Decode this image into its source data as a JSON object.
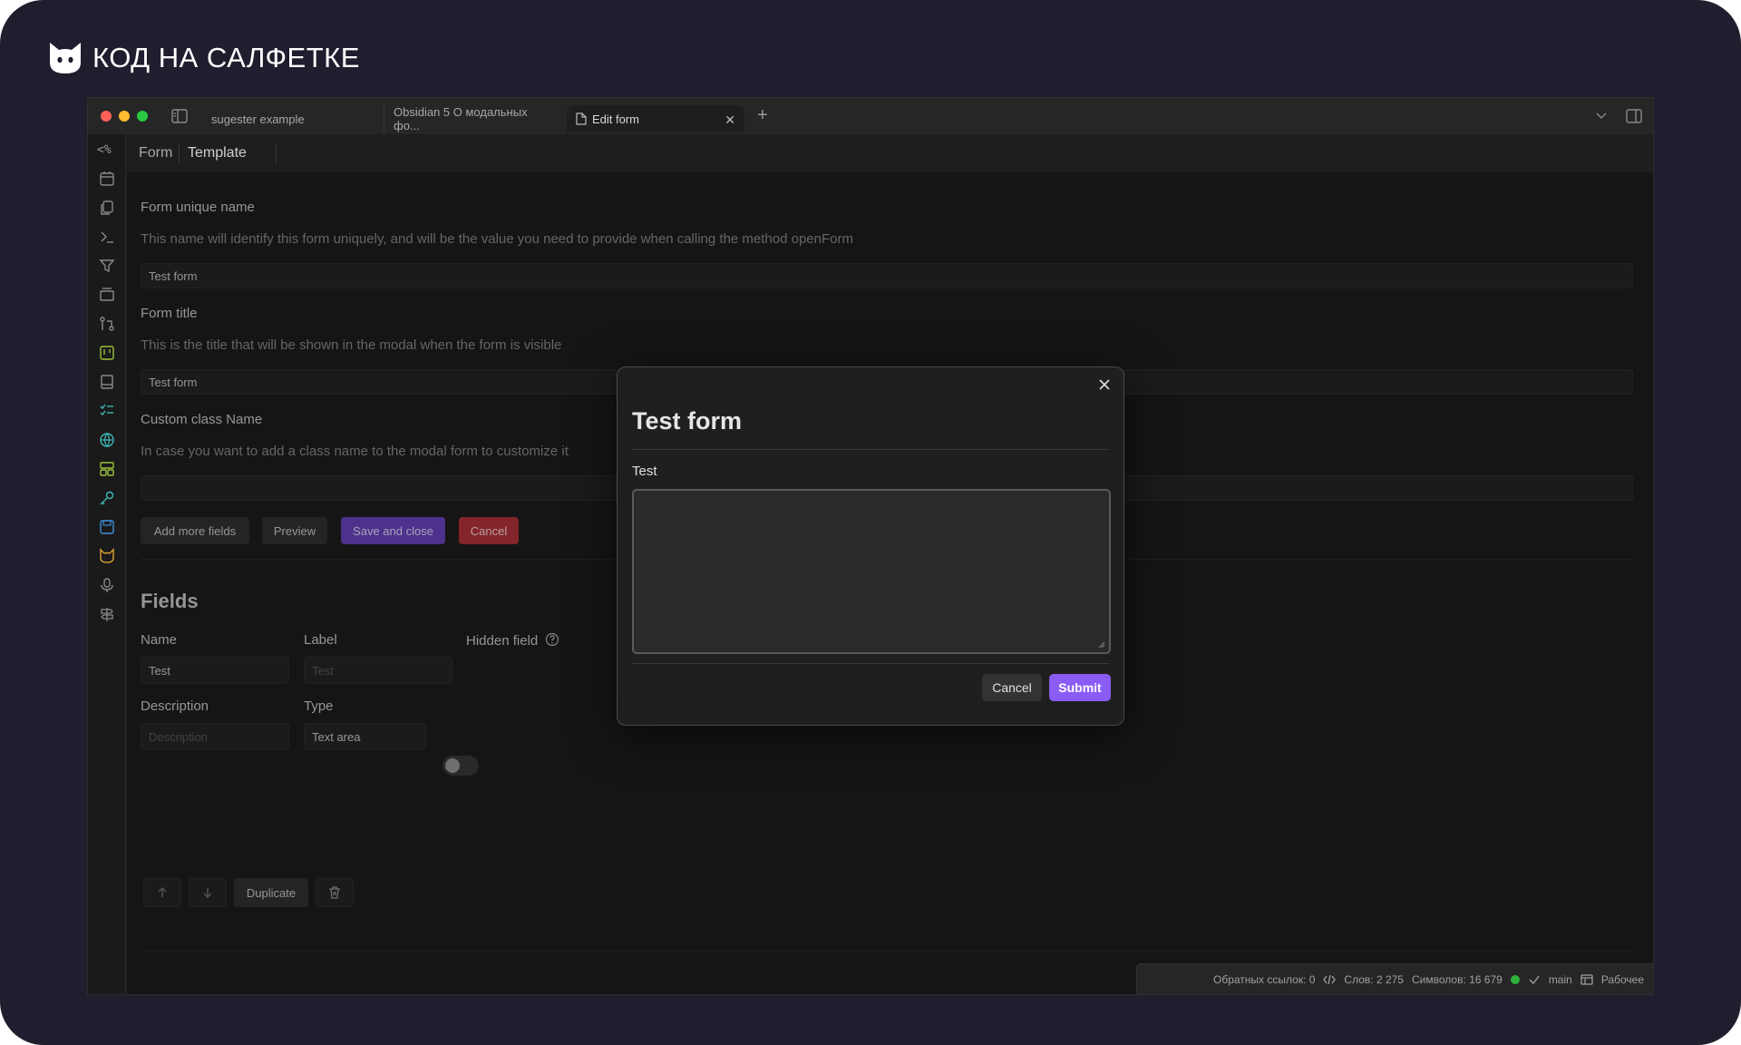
{
  "brand": {
    "text": "КОД НА САЛФЕТКЕ"
  },
  "tabs": [
    {
      "label": "sugester example"
    },
    {
      "label": "Obsidian 5 О модальных фо..."
    },
    {
      "label": "Edit form",
      "active": true
    }
  ],
  "ribbon": {
    "templater_label": "<%"
  },
  "view_header": {
    "form": "Form",
    "template": "Template"
  },
  "form": {
    "unique_name": {
      "title": "Form unique name",
      "desc": "This name will identify this form uniquely, and will be the value you need to provide when calling the method openForm",
      "value": "Test form"
    },
    "form_title": {
      "title": "Form title",
      "desc": "This is the title that will be shown in the modal when the form is visible",
      "value": "Test form"
    },
    "custom_class": {
      "title": "Custom class Name",
      "desc": "In case you want to add a class name to the modal form to customize it",
      "value": ""
    },
    "buttons": {
      "add_more": "Add more fields",
      "preview": "Preview",
      "save": "Save and close",
      "cancel": "Cancel"
    }
  },
  "fields": {
    "heading": "Fields",
    "name_label": "Name",
    "name_value": "Test",
    "label_label": "Label",
    "label_placeholder": "Test",
    "hidden_label": "Hidden field",
    "hidden_on": false,
    "description_label": "Description",
    "description_placeholder": "Description",
    "type_label": "Type",
    "type_value": "Text area",
    "duplicate": "Duplicate"
  },
  "statusbar": {
    "backlinks": "Обратных ссылок: 0",
    "words": "Слов: 2 275",
    "chars": "Символов: 16 679",
    "branch": "main",
    "workspace": "Рабочее"
  },
  "modal": {
    "title": "Test form",
    "field_label": "Test",
    "cancel": "Cancel",
    "submit": "Submit"
  },
  "colors": {
    "accent": "#8a5cf5",
    "danger": "#b8333c",
    "sync_ok": "#2fb13a"
  }
}
